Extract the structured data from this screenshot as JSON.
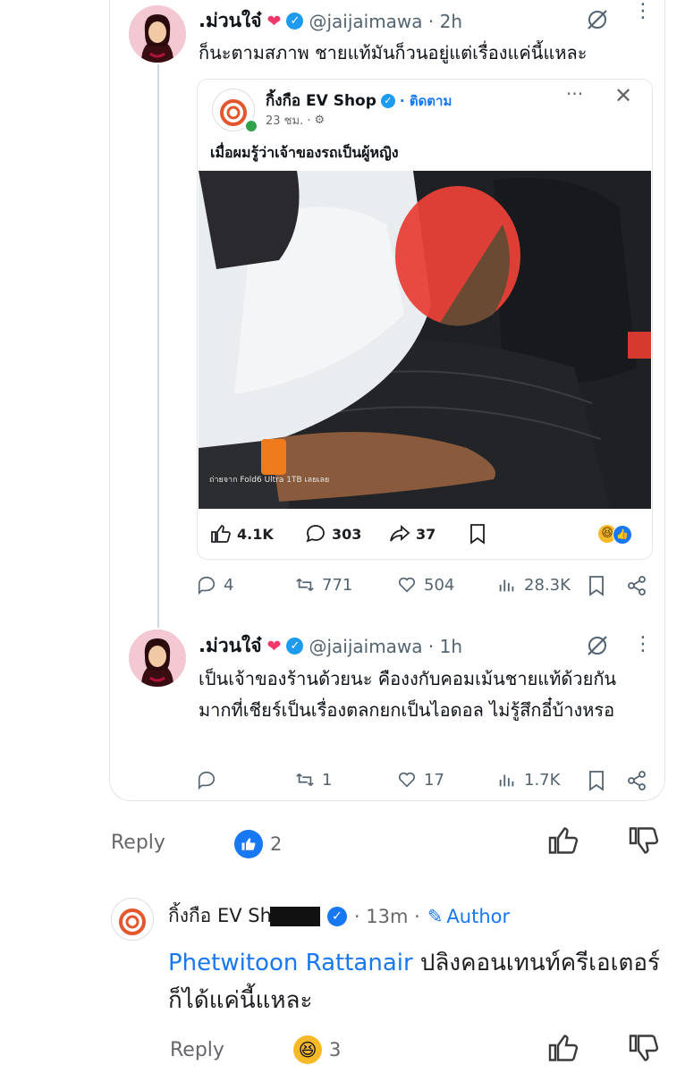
{
  "tweet1": {
    "name": ".ม่วนใจ๋",
    "handle": "@jaijaimawa · 2h",
    "text": "ก็นะตามสภาพ ชายแท้มันก็วนอยู่แต่เรื่องแค่นี้แหละ"
  },
  "embed": {
    "page_name": "กิ้งกือ EV Shop",
    "follow": "· ติดตาม",
    "time": "23 ชม. ·",
    "caption": "เมื่อผมรู้ว่าเจ้าของรถเป็นผู้หญิง",
    "photo_watermark": "ถ่ายจาก Fold6 Ultra 1TB เลยเลย",
    "likes": "4.1K",
    "comments": "303",
    "shares": "37",
    "logo_text": "กิ้งกือ EV Shop"
  },
  "tweet1_stats": {
    "replies": "4",
    "retweets": "771",
    "likes": "504",
    "views": "28.3K"
  },
  "tweet2": {
    "name": ".ม่วนใจ๋",
    "handle": "@jaijaimawa · 1h",
    "text": "เป็นเจ้าของร้านด้วยนะ คืองงกับคอมเม้นชายแท้ด้วยกันมากที่เชียร์เป็นเรื่องตลกยกเป็นไอดอล ไม่รู้สึกอี๋บ้างหรอ"
  },
  "tweet2_stats": {
    "replies": "",
    "retweets": "1",
    "likes": "17",
    "views": "1.7K"
  },
  "comment1_actions": {
    "reply": "Reply",
    "reaction_count": "2"
  },
  "comment2": {
    "name": "กิ้งกือ EV Sh",
    "time": "· 13m ·",
    "author_badge": "Author",
    "mention": "Phetwitoon Rattanair",
    "text": " ปลิงคอนเทนท์ครีเอเตอร์ก็ได้แค่นี้แหละ",
    "reply": "Reply",
    "reaction_count": "3"
  },
  "colors": {
    "x_blue": "#1d9bf0",
    "fb_blue": "#1877f2",
    "heart": "#f0386b",
    "muted": "#536471"
  }
}
